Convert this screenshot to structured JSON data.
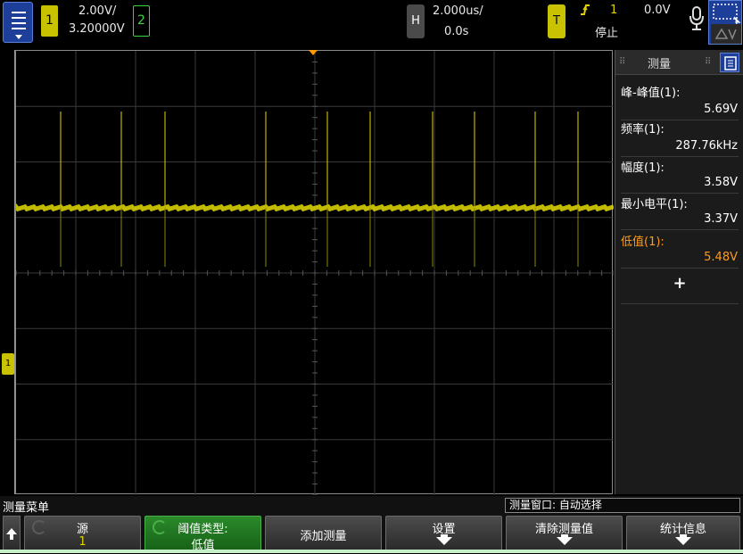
{
  "top": {
    "ch1_num": "1",
    "ch1_scale": "2.00V/",
    "ch1_offset": "3.20000V",
    "ch2_num": "2",
    "h_label": "H",
    "h_scale": "2.000us/",
    "h_delay": "0.0s",
    "t_label": "T",
    "trig_source": "1",
    "trig_level": "0.0V",
    "run_state": "停止"
  },
  "sidebar": {
    "title": "测量",
    "measurements": [
      {
        "label": "峰-峰值(1):",
        "value": "5.69V",
        "highlight": false
      },
      {
        "label": "频率(1):",
        "value": "287.76kHz",
        "highlight": false
      },
      {
        "label": "幅度(1):",
        "value": "3.58V",
        "highlight": false
      },
      {
        "label": "最小电平(1):",
        "value": "3.37V",
        "highlight": false
      },
      {
        "label": "低值(1):",
        "value": "5.48V",
        "highlight": true
      }
    ],
    "add_symbol": "+"
  },
  "bottom": {
    "menu_title": "测量菜单",
    "window_status": "测量窗口: 自动选择",
    "softkeys": {
      "source_l1": "源",
      "source_l2": "1",
      "threshold_l1": "阈值类型:",
      "threshold_l2": "低值",
      "add": "添加测量",
      "settings": "设置",
      "clear": "清除测量值",
      "stats": "统计信息"
    }
  },
  "markers": {
    "ground": "1"
  },
  "colors": {
    "ch1": "#c9c200",
    "ch2": "#3fd33f",
    "accent": "#1d3f9a",
    "highlight": "#ff9a1a"
  }
}
